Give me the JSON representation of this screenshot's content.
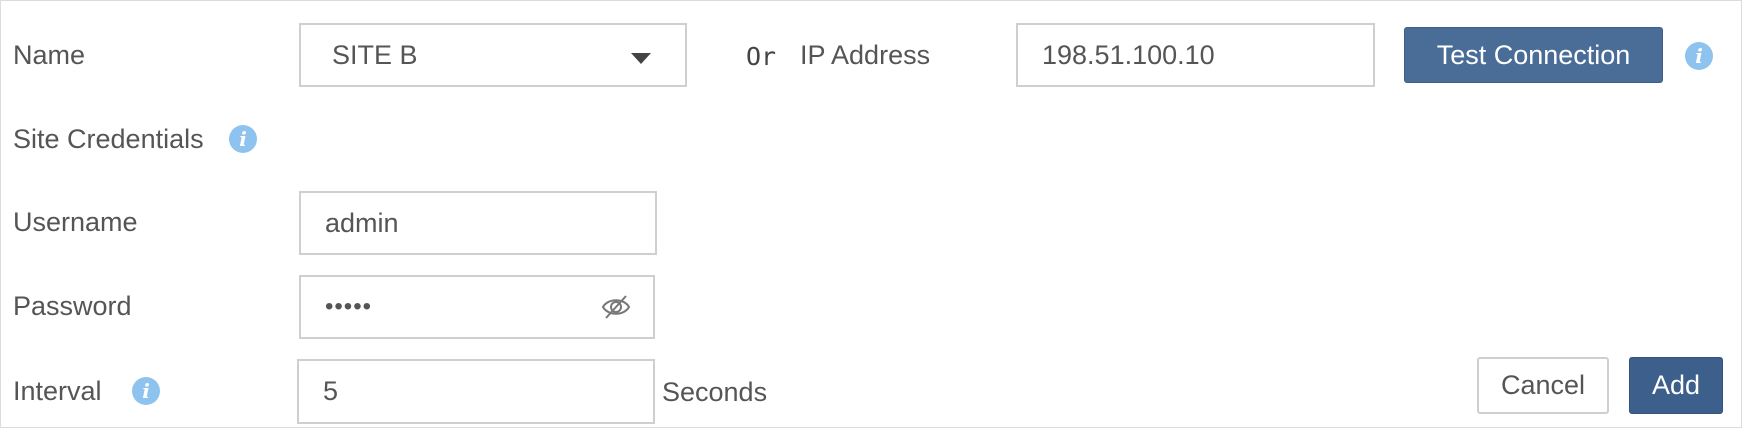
{
  "form": {
    "name_label": "Name",
    "name_select": {
      "value": "SITE B"
    },
    "or_label": "Or",
    "ip_label": "IP Address",
    "ip_input": {
      "value": "198.51.100.10"
    },
    "test_connection_label": "Test Connection",
    "site_credentials_label": "Site Credentials",
    "username_label": "Username",
    "username_input": {
      "value": "admin"
    },
    "password_label": "Password",
    "password_input": {
      "value": "•••••"
    },
    "interval_label": "Interval",
    "interval_input": {
      "value": "5"
    },
    "seconds_label": "Seconds",
    "info_glyph": "i"
  },
  "actions": {
    "cancel_label": "Cancel",
    "add_label": "Add"
  },
  "icons": {
    "info": "info-icon",
    "dropdown": "caret-down-icon",
    "password_toggle": "eye-slash-icon"
  },
  "colors": {
    "primary_button": "#4a6d98",
    "add_button": "#3c5f8c",
    "info_icon": "#8fc3ef",
    "field_border": "#cfcfcf",
    "text": "#555555"
  }
}
